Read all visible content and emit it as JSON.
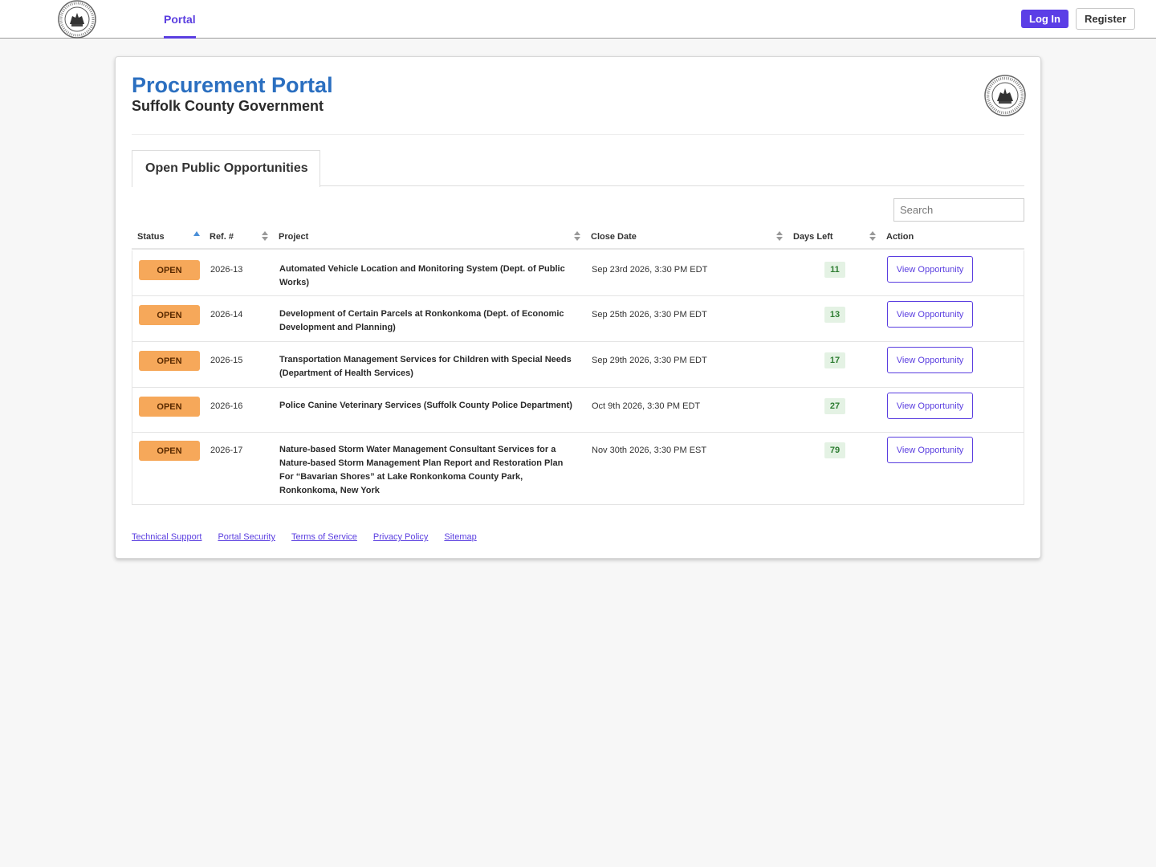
{
  "nav": {
    "portal_tab": "Portal",
    "login_label": "Log In",
    "register_label": "Register"
  },
  "header": {
    "title": "Procurement Portal",
    "subtitle": "Suffolk County Government"
  },
  "tabs": [
    {
      "label": "Open Public Opportunities",
      "active": true
    }
  ],
  "search": {
    "placeholder": "Search",
    "value": ""
  },
  "table": {
    "columns": [
      "Status",
      "Ref. #",
      "Project",
      "Close Date",
      "Days Left",
      "Action"
    ],
    "sorted_column": "Status",
    "rows": [
      {
        "status": "OPEN",
        "ref": "2026-13",
        "project": "Automated Vehicle Location and Monitoring System (Dept. of Public Works)",
        "close_date": "Sep 23rd 2026, 3:30 PM EDT",
        "days_left": "11",
        "action": "View Opportunity"
      },
      {
        "status": "OPEN",
        "ref": "2026-14",
        "project": "Development of Certain Parcels at Ronkonkoma (Dept. of Economic Development and Planning)",
        "close_date": "Sep 25th 2026, 3:30 PM EDT",
        "days_left": "13",
        "action": "View Opportunity"
      },
      {
        "status": "OPEN",
        "ref": "2026-15",
        "project": "Transportation Management Services for Children with Special Needs (Department of Health Services)",
        "close_date": "Sep 29th 2026, 3:30 PM EDT",
        "days_left": "17",
        "action": "View Opportunity"
      },
      {
        "status": "OPEN",
        "ref": "2026-16",
        "project": "Police Canine Veterinary Services (Suffolk County Police Department)",
        "close_date": "Oct 9th 2026, 3:30 PM EDT",
        "days_left": "27",
        "action": "View Opportunity"
      },
      {
        "status": "OPEN",
        "ref": "2026-17",
        "project": "Nature-based Storm Water Management Consultant Services for a Nature-based Storm Management Plan Report and Restoration Plan For “Bavarian Shores” at Lake Ronkonkoma County Park, Ronkonkoma, New York",
        "close_date": "Nov 30th 2026, 3:30 PM EST",
        "days_left": "79",
        "action": "View Opportunity"
      }
    ]
  },
  "footer": {
    "links": [
      "Technical Support",
      "Portal Security",
      "Terms of Service",
      "Privacy Policy",
      "Sitemap"
    ]
  },
  "colors": {
    "accent": "#5a3ee0",
    "title_blue": "#2b6fc0",
    "status_open": "#f6a85a",
    "days_bg": "#e4f2e4"
  }
}
